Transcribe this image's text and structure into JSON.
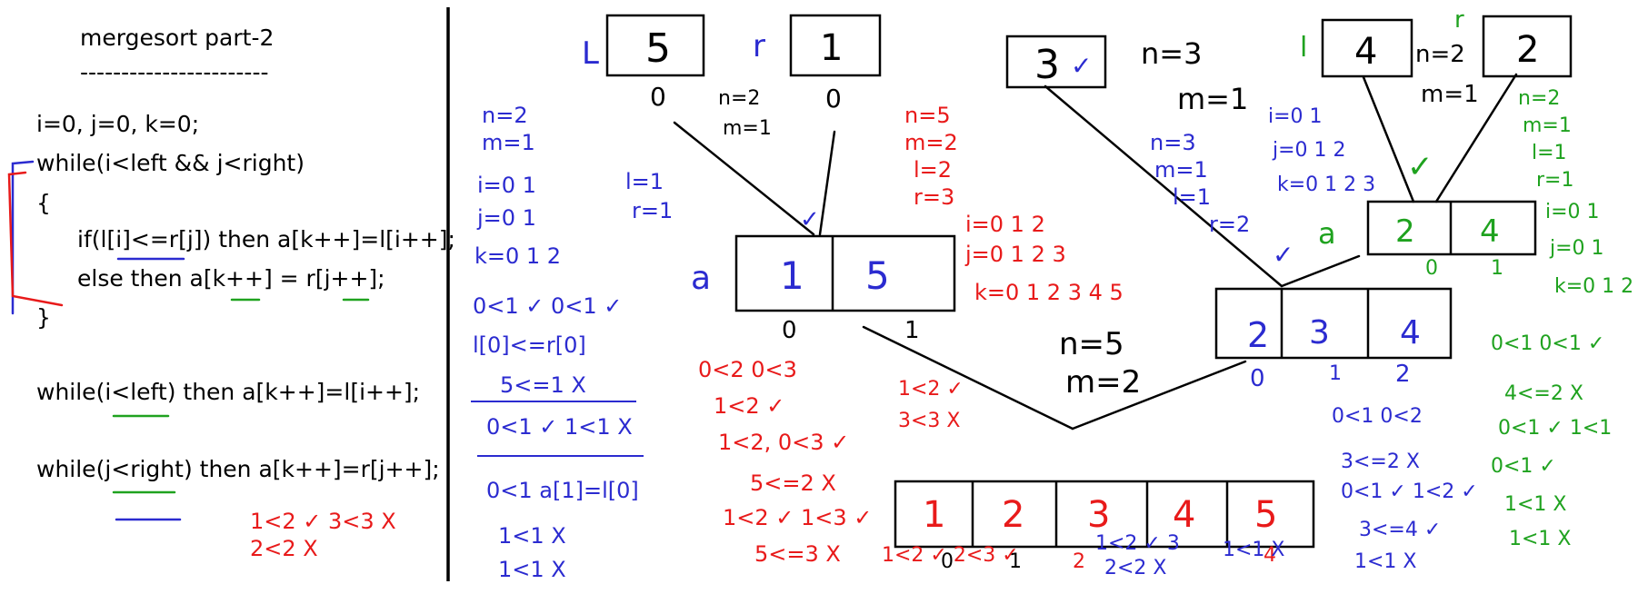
{
  "code": {
    "title": "mergesort part-2",
    "rule": "-----------------------",
    "lines": [
      "i=0, j=0, k=0;",
      "while(i<left && j<right)",
      "{",
      "if(l[i]<=r[j]) then a[k++]=l[i++];",
      "else then a[k++] = r[j++];",
      "}",
      "while(i<left) then a[k++]=l[i++];",
      "while(j<right) then a[k++]=r[j++];"
    ]
  },
  "colors": {
    "black": "#000000",
    "blue": "#2b2bd0",
    "red": "#e81a1a",
    "green": "#1fa21f"
  },
  "boxes": {
    "l_label": "L",
    "l_value": "5",
    "l_index": "0",
    "r_label": "r",
    "r_value": "1",
    "r_index": "0",
    "a1_label": "a",
    "a1_values": [
      "1",
      "5"
    ],
    "a1_index": [
      "0",
      "1"
    ],
    "b3_value": "3",
    "l2_label": "l",
    "l2_value": "4",
    "r2_label": "r",
    "r2_value": "2",
    "a2_label": "a",
    "a2_values": [
      "2",
      "4"
    ],
    "a2_index": [
      "0",
      "1"
    ],
    "m3_values": [
      "2",
      "3",
      "4"
    ],
    "m3_index": [
      "0",
      "1",
      "2"
    ],
    "final_values": [
      "1",
      "2",
      "3",
      "4",
      "5"
    ],
    "final_index": [
      "0",
      "1",
      "2",
      "4"
    ]
  },
  "notes": {
    "blue_left": [
      "n=2",
      "m=1",
      "i=0 1",
      "j=0 1",
      "k=0 1 2",
      "0<1 ✓ 0<1 ✓",
      "l[0]<=r[0]",
      "5<=1 X",
      "0<1 ✓   1<1 X",
      "0<1     a[1]=l[0]",
      "1<1 X",
      "1<1 X"
    ],
    "blue_lr": [
      "l=1",
      "r=1"
    ],
    "black_nm1": [
      "n=2",
      "m=1"
    ],
    "red_mid": [
      "n=5",
      "m=2",
      "l=2",
      "r=3"
    ],
    "red_ijk": [
      "i=0 1 2",
      "j=0 1 2 3",
      "k=0 1 2 3 4 5"
    ],
    "red_compare": [
      "0<2   0<3",
      "1<2 ✓",
      "1<2, 0<3 ✓",
      "5<=2 X",
      "1<2 ✓  1<3 ✓",
      "5<=3 X"
    ],
    "red_middle2": [
      "1<2 ✓",
      "3<3 X"
    ],
    "red_bottom_left": [
      "1<2 ✓   3<3 X",
      "2<2 X"
    ],
    "red_under_final": [
      "1<2 ✓  2<3 ✓"
    ],
    "black_nm5": [
      "n=5",
      "m=2"
    ],
    "black_nm3": [
      "n=3",
      "m=1"
    ],
    "black_nm2": [
      "n=2",
      "m=1"
    ],
    "blue_right": [
      "n=3",
      "m=1",
      "l=1",
      "r=2"
    ],
    "blue_ijk2": [
      "i=0 1",
      "j=0 1 2",
      "k=0 1 2 3"
    ],
    "blue_compare2": [
      "0<1  0<2",
      "3<=2 X",
      "0<1 ✓ 1<2 ✓",
      "3<=4 ✓",
      "1<1 X"
    ],
    "blue_under_final": [
      "1<2 ✓ 3",
      "2<2 X",
      "1<1 X"
    ],
    "green_right": [
      "n=2",
      "m=1",
      "l=1",
      "r=1",
      "i=0 1",
      "j=0 1",
      "k=0 1 2",
      "0<1   0<1 ✓",
      "4<=2 X",
      "0<1 ✓  1<1",
      "0<1 ✓",
      "1<1 X",
      "1<1 X"
    ],
    "green_r_label": "r"
  }
}
